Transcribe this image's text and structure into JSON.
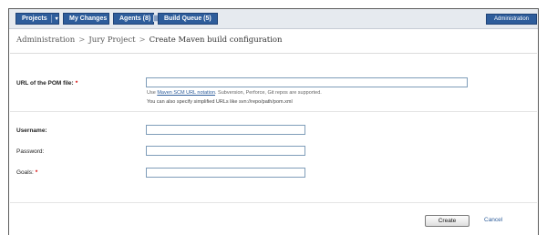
{
  "nav": {
    "tabs": [
      {
        "label": "Projects"
      },
      {
        "label": "My Changes"
      },
      {
        "label": "Agents (8)"
      },
      {
        "label": "Build Queue (5)"
      }
    ],
    "admin_label": "Administration"
  },
  "breadcrumb": {
    "root": "Administration",
    "separator": ">",
    "project": "Jury Project",
    "current": "Create Maven build configuration"
  },
  "form": {
    "pom_url_label": "URL of the POM file:",
    "pom_url_value": "",
    "pom_hint_prefix": "Use",
    "pom_hint_link": "Maven SCM URL notation",
    "pom_hint_suffix": ". Subversion, Perforce, Git repos are supported.",
    "pom_hint_line2": "You can also specify simplified URLs like svn://repo/path/pom.xml",
    "username_label": "Username:",
    "username_value": "",
    "password_label": "Password:",
    "password_value": "",
    "goals_label": "Goals:",
    "goals_value": "",
    "required_mark": "*"
  },
  "actions": {
    "create_label": "Create",
    "cancel_label": "Cancel"
  },
  "colors": {
    "tab_bg": "#2e5d9b",
    "link": "#2e5d9b",
    "required": "#d40000"
  }
}
